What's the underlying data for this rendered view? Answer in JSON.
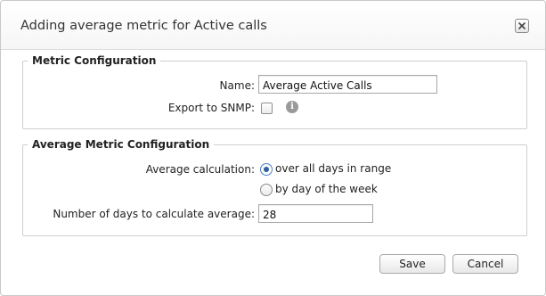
{
  "dialog": {
    "title": "Adding average metric for Active calls",
    "close_icon": "close-icon"
  },
  "metric_configuration": {
    "legend": "Metric Configuration",
    "name_label": "Name:",
    "name_value": "Average Active Calls",
    "export_label": "Export to SNMP:",
    "export_checked": false,
    "info_icon": "info-icon",
    "info_glyph": "i"
  },
  "average_metric_configuration": {
    "legend": "Average Metric Configuration",
    "calculation_label": "Average calculation:",
    "options": [
      {
        "label": "over all days in range",
        "selected": true
      },
      {
        "label": "by day of the week",
        "selected": false
      }
    ],
    "days_label": "Number of days to calculate average:",
    "days_value": "28"
  },
  "actions": {
    "save_label": "Save",
    "cancel_label": "Cancel"
  }
}
